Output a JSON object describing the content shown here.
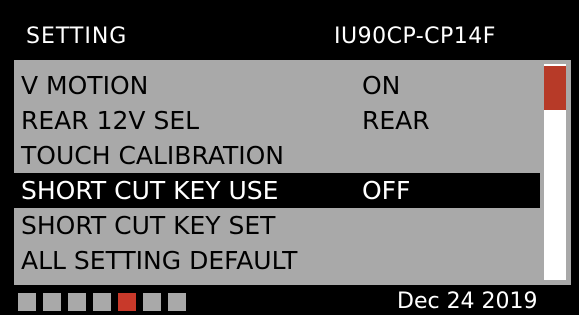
{
  "header": {
    "title": "SETTING",
    "model": "IU90CP-CP14F"
  },
  "menu": {
    "items": [
      {
        "label": "V MOTION",
        "value": "ON",
        "selected": false
      },
      {
        "label": "REAR 12V SEL",
        "value": "REAR",
        "selected": false
      },
      {
        "label": "TOUCH CALIBRATION",
        "value": "",
        "selected": false
      },
      {
        "label": "SHORT CUT KEY USE",
        "value": "OFF",
        "selected": true
      },
      {
        "label": "SHORT CUT KEY SET",
        "value": "",
        "selected": false
      },
      {
        "label": "ALL SETTING DEFAULT",
        "value": "",
        "selected": false
      }
    ]
  },
  "pager": {
    "total": 7,
    "current": 5
  },
  "footer": {
    "date": "Dec 24 2019"
  },
  "colors": {
    "background": "#000000",
    "panel": "#a9a9a9",
    "selected_row": "#000000",
    "accent": "#c8392a",
    "scrollbar_track": "#ffffff"
  }
}
